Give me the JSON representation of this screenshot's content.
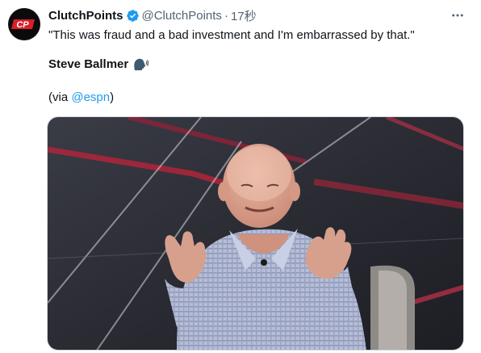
{
  "tweet": {
    "display_name": "ClutchPoints",
    "handle": "@ClutchPoints",
    "separator": "·",
    "time": "17秒",
    "avatar_text": "CP",
    "quote": "\"This was fraud and a bad investment and I'm embarrassed by that.\"",
    "speaker_name": "Steve Ballmer",
    "via_prefix": "(via ",
    "via_mention": "@espn",
    "via_suffix": ")",
    "icons": {
      "verified": "verified-badge-icon",
      "more": "more-options-icon",
      "speaking": "speaking-head-icon"
    },
    "colors": {
      "verified": "#1d9bf0",
      "link": "#1d9bf0",
      "avatar_red": "#d6202a",
      "muted": "#536471"
    }
  }
}
